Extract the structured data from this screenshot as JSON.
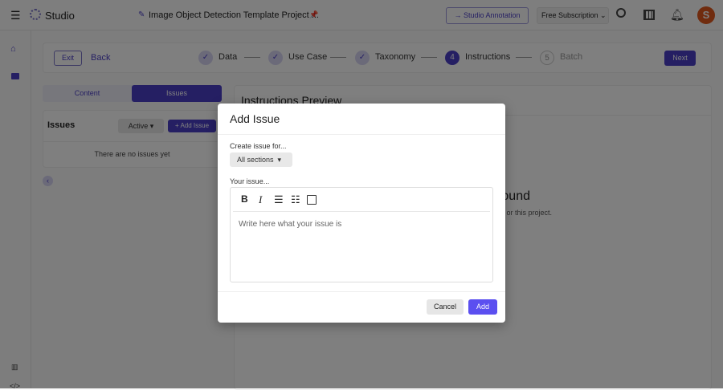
{
  "header": {
    "app_name": "Studio",
    "project_title": "Image Object Detection Template Project ...",
    "studio_annotation": "Studio Annotation",
    "subscription": "Free Subscription"
  },
  "steps": {
    "exit": "Exit",
    "back": "Back",
    "next": "Next",
    "items": [
      {
        "label": "Data",
        "state": "done"
      },
      {
        "label": "Use Case",
        "state": "done"
      },
      {
        "label": "Taxonomy",
        "state": "done"
      },
      {
        "num": "4",
        "label": "Instructions",
        "state": "active"
      },
      {
        "num": "5",
        "label": "Batch",
        "state": "pending"
      }
    ]
  },
  "left_panel": {
    "tabs": [
      "Content",
      "Issues"
    ],
    "issues_title": "Issues",
    "filter": "Active",
    "add_issue": "+ Add Issue",
    "empty": "There are no issues yet"
  },
  "preview": {
    "title": "Instructions Preview",
    "heading": "ound",
    "sub": "or this project."
  },
  "modal": {
    "title": "Add Issue",
    "create_for_label": "Create issue for...",
    "section_select": "All sections",
    "issue_label": "Your issue...",
    "placeholder": "Write here what your issue is",
    "cancel": "Cancel",
    "add": "Add"
  },
  "colors": {
    "accent": "#4b3fc7",
    "add_button": "#5b4ff0"
  }
}
